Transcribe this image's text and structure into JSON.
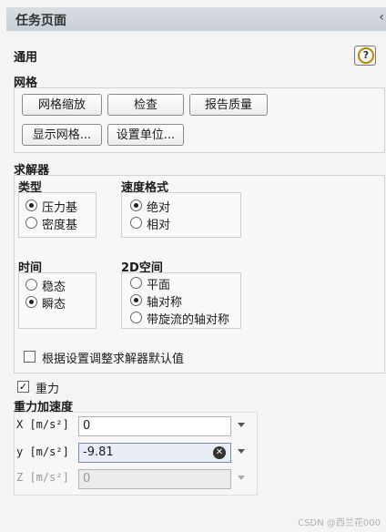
{
  "header": {
    "title": "任务页面",
    "collapse_icon": "chevron-left-icon"
  },
  "general": {
    "label": "通用",
    "help_icon": "help-icon",
    "help_glyph": "?"
  },
  "mesh": {
    "label": "网格",
    "buttons": {
      "scale": "网格缩放",
      "check": "检查",
      "report_quality": "报告质量",
      "display": "显示网格...",
      "units": "设置单位..."
    }
  },
  "solver": {
    "label": "求解器",
    "type": {
      "label": "类型",
      "options": [
        "压力基",
        "密度基"
      ],
      "selected": "压力基"
    },
    "velocity": {
      "label": "速度格式",
      "options": [
        "绝对",
        "相对"
      ],
      "selected": "绝对"
    },
    "time": {
      "label": "时间",
      "options": [
        "稳态",
        "瞬态"
      ],
      "selected": "瞬态"
    },
    "space": {
      "label": "2D空间",
      "options": [
        "平面",
        "轴对称",
        "带旋流的轴对称"
      ],
      "selected": "轴对称"
    },
    "adjust_defaults": {
      "label": "根据设置调整求解器默认值",
      "checked": false
    }
  },
  "gravity": {
    "checkbox_label": "重力",
    "checked": true,
    "check_glyph": "✓",
    "section_label": "重力加速度",
    "x": {
      "label": "X [m/s²]",
      "value": "0"
    },
    "y": {
      "label": "y [m/s²]",
      "value": "-9.81",
      "clear_glyph": "✕"
    },
    "z": {
      "label": "Z [m/s²]",
      "value": "0"
    }
  },
  "footer": {
    "watermark": "CSDN @西兰花000"
  }
}
